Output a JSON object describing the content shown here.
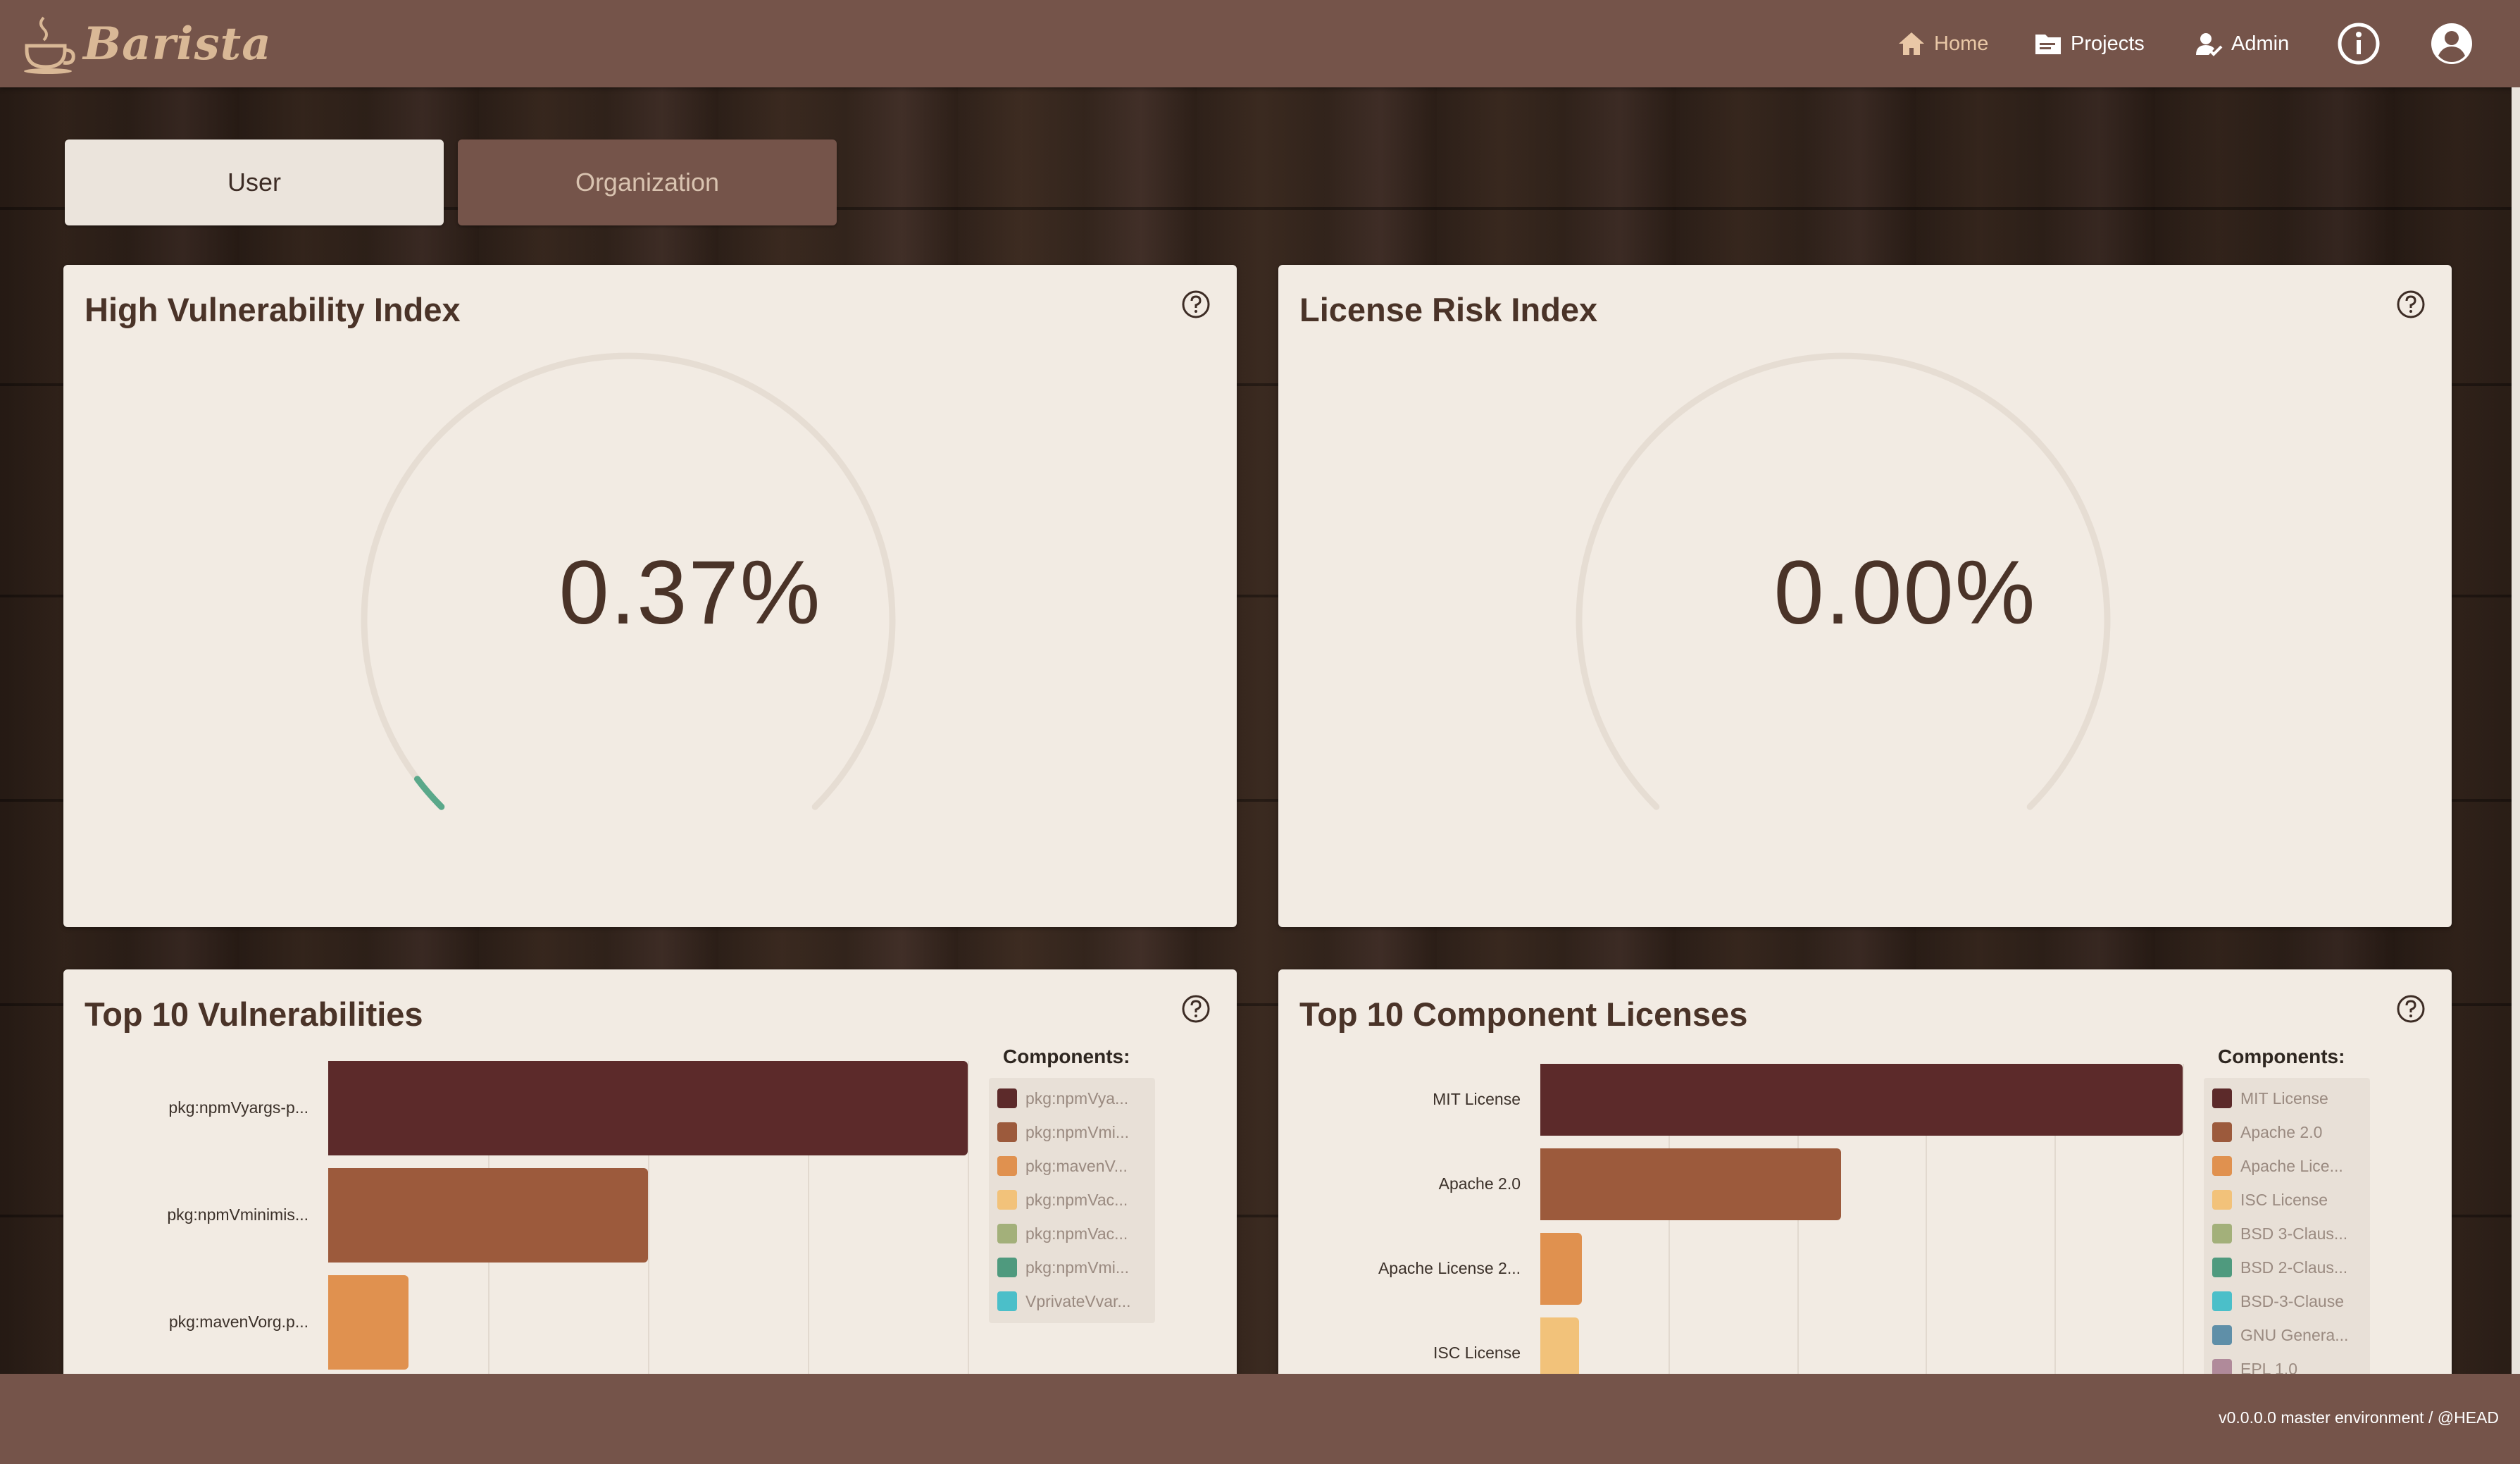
{
  "app": {
    "name": "Barista",
    "version_text": "v0.0.0.0 master environment / @HEAD"
  },
  "nav": {
    "home": "Home",
    "projects": "Projects",
    "admin": "Admin",
    "icons": [
      "home-icon",
      "projects-icon",
      "admin-icon",
      "info-icon",
      "user-account-icon"
    ]
  },
  "tabs": {
    "user": "User",
    "organization": "Organization",
    "active": "User"
  },
  "cards": {
    "high_vuln": {
      "title": "High Vulnerability Index",
      "value_text": "0.37%",
      "value_fraction": 0.0037,
      "color": "#5aa88a"
    },
    "license_risk": {
      "title": "License Risk Index",
      "value_text": "0.00%",
      "value_fraction": 0.0
    },
    "top_vulns": {
      "title": "Top 10 Vulnerabilities",
      "legend_title": "Components:",
      "legend": [
        {
          "label": "pkg:npmVya...",
          "color": "#5c2a2a"
        },
        {
          "label": "pkg:npmVmi...",
          "color": "#9c5a3c"
        },
        {
          "label": "pkg:mavenV...",
          "color": "#e0914f"
        },
        {
          "label": "pkg:npmVac...",
          "color": "#f2c27a"
        },
        {
          "label": "pkg:npmVac...",
          "color": "#a3b07a"
        },
        {
          "label": "pkg:npmVmi...",
          "color": "#4f9a7e"
        },
        {
          "label": "VprivateVvar...",
          "color": "#4bbfc9"
        }
      ],
      "rows": [
        {
          "label": "pkg:npmVyargs-p...",
          "value": 4,
          "color": "#5c2a2a"
        },
        {
          "label": "pkg:npmVminimis...",
          "value": 2,
          "color": "#9c5a3c"
        },
        {
          "label": "pkg:mavenVorg.p...",
          "value": 0.5,
          "color": "#e0914f"
        }
      ]
    },
    "top_licenses": {
      "title": "Top 10 Component Licenses",
      "legend_title": "Components:",
      "legend": [
        {
          "label": "MIT License",
          "color": "#5c2a2a"
        },
        {
          "label": "Apache 2.0",
          "color": "#9c5a3c"
        },
        {
          "label": "Apache Lice...",
          "color": "#e0914f"
        },
        {
          "label": "ISC License",
          "color": "#f2c27a"
        },
        {
          "label": "BSD 3-Claus...",
          "color": "#a3b07a"
        },
        {
          "label": "BSD 2-Claus...",
          "color": "#4f9a7e"
        },
        {
          "label": "BSD-3-Clause",
          "color": "#4bbfc9"
        },
        {
          "label": "GNU Genera...",
          "color": "#5f8fa8"
        },
        {
          "label": "EPL 1.0",
          "color": "#b08a9a"
        }
      ],
      "rows": [
        {
          "label": "MIT License",
          "value": 100,
          "color": "#5c2a2a"
        },
        {
          "label": "Apache 2.0",
          "value": 46.8,
          "color": "#9c5a3c"
        },
        {
          "label": "Apache License 2...",
          "value": 6.5,
          "color": "#e0914f"
        },
        {
          "label": "ISC License",
          "value": 6,
          "color": "#f2c27a"
        }
      ]
    }
  }
}
